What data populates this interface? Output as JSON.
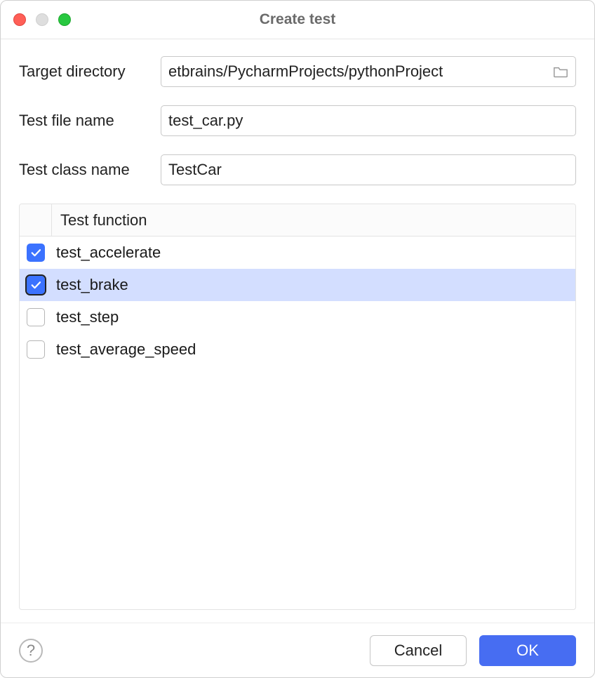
{
  "title": "Create test",
  "form": {
    "target_directory_label": "Target directory",
    "target_directory_value": "etbrains/PycharmProjects/pythonProject",
    "test_file_label": "Test file name",
    "test_file_value": "test_car.py",
    "test_class_label": "Test class name",
    "test_class_value": "TestCar"
  },
  "table": {
    "header": "Test function",
    "rows": [
      {
        "label": "test_accelerate",
        "checked": true,
        "selected": false,
        "focused": false
      },
      {
        "label": "test_brake",
        "checked": true,
        "selected": true,
        "focused": true
      },
      {
        "label": "test_step",
        "checked": false,
        "selected": false,
        "focused": false
      },
      {
        "label": "test_average_speed",
        "checked": false,
        "selected": false,
        "focused": false
      }
    ]
  },
  "footer": {
    "help": "?",
    "cancel": "Cancel",
    "ok": "OK"
  }
}
